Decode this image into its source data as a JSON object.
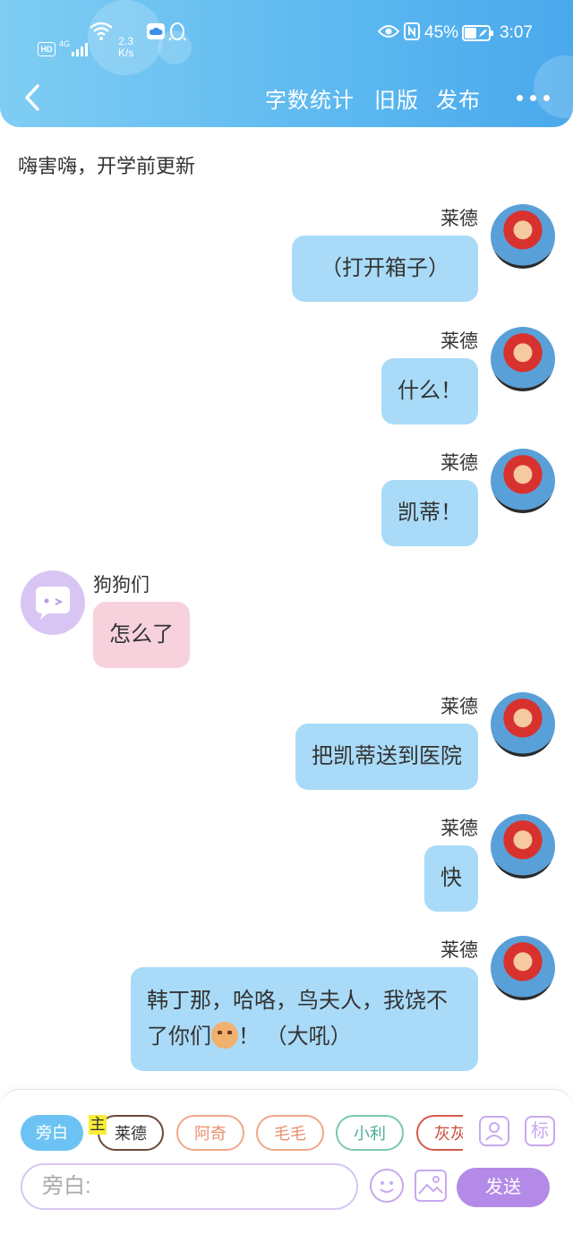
{
  "status_bar": {
    "hd": "HD",
    "network": "4G",
    "speed_value": "2.3",
    "speed_unit": "K/s",
    "battery": "45%",
    "time": "3:07"
  },
  "nav": {
    "word_count": "字数统计",
    "old_version": "旧版",
    "publish": "发布"
  },
  "intro_text": "嗨害嗨，开学前更新",
  "messages": [
    {
      "name": "莱德",
      "text": "（打开箱子）"
    },
    {
      "name": "莱德",
      "text": "什么！"
    },
    {
      "name": "莱德",
      "text": "凯蒂！"
    },
    {
      "name": "狗狗们",
      "text": "怎么了"
    },
    {
      "name": "莱德",
      "text": "把凯蒂送到医院"
    },
    {
      "name": "莱德",
      "text": "快"
    },
    {
      "name": "莱德",
      "text_before_emoji": "韩丁那，哈咯，鸟夫人，我饶不了你们",
      "text_after_emoji": "！ （大吼）"
    }
  ],
  "composer": {
    "chips": [
      "旁白",
      "莱德",
      "阿奇",
      "毛毛",
      "小利",
      "灰灰"
    ],
    "host_badge": "主",
    "tag_icon_label": "标",
    "input_placeholder": "旁白:",
    "send_label": "发送"
  },
  "colors": {
    "header_gradient_start": "#7fcdf3",
    "right_bubble": "#a9dbf8",
    "left_bubble": "#f7d2dc",
    "send_button": "#b48ae8",
    "active_chip": "#6cc3f3"
  }
}
